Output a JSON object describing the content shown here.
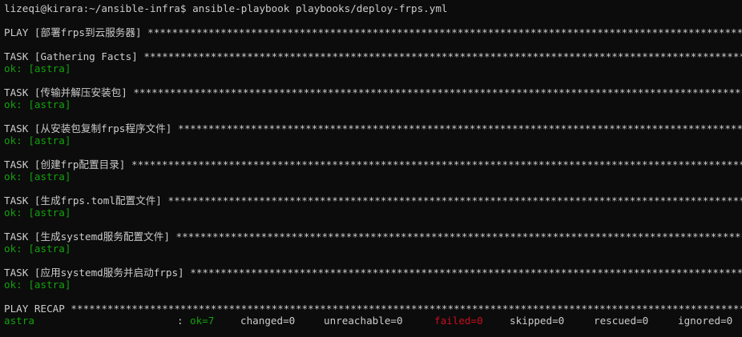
{
  "terminal": {
    "prompt": "lizeqi@kirara:~/ansible-infra$",
    "command": "ansible-playbook playbooks/deploy-frps.yml",
    "stars": "****************************************************************************************************************************************************************",
    "play": {
      "label": "PLAY [部署frps到云服务器]"
    },
    "tasks": [
      {
        "label": "TASK [Gathering Facts]",
        "result": "ok: [astra]"
      },
      {
        "label": "TASK [传输并解压安装包]",
        "result": "ok: [astra]"
      },
      {
        "label": "TASK [从安装包复制frps程序文件]",
        "result": "ok: [astra]"
      },
      {
        "label": "TASK [创建frp配置目录]",
        "result": "ok: [astra]"
      },
      {
        "label": "TASK [生成frps.toml配置文件]",
        "result": "ok: [astra]"
      },
      {
        "label": "TASK [生成systemd服务配置文件]",
        "result": "ok: [astra]"
      },
      {
        "label": "TASK [应用systemd服务并启动frps]",
        "result": "ok: [astra]"
      }
    ],
    "recap": {
      "label": "PLAY RECAP",
      "host": "astra",
      "colon": ":",
      "ok": "ok=7",
      "changed": "changed=0",
      "unreachable": "unreachable=0",
      "failed": "failed=0",
      "skipped": "skipped=0",
      "rescued": "rescued=0",
      "ignored": "ignored=0"
    },
    "colors": {
      "background": "#0c0c0c",
      "foreground": "#cccccc",
      "ok": "#13a10e",
      "failed": "#c50f1f"
    }
  }
}
